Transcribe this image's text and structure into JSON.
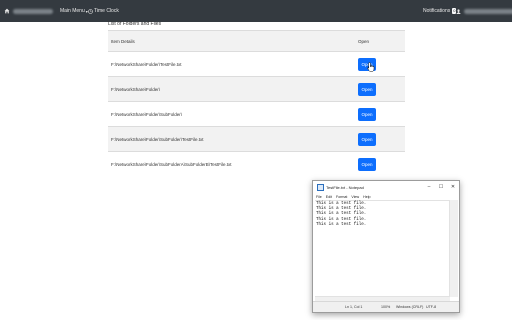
{
  "navbar": {
    "menu_label": "Main Menu",
    "time_clock_label": "Time Clock",
    "notifications_label": "Notifications",
    "notifications_count": "0"
  },
  "section_title": "List of Folders and Files",
  "table": {
    "headers": [
      "Item Details",
      "Open"
    ],
    "rows": [
      {
        "path": "F:\\NetworkShare\\Folder\\TestFile.txt",
        "action": "Open"
      },
      {
        "path": "F:\\NetworkShare\\Folder\\",
        "action": "Open"
      },
      {
        "path": "F:\\NetworkShare\\Folder\\SubFolder\\",
        "action": "Open"
      },
      {
        "path": "F:\\NetworkShare\\Folder\\SubFolder\\TestFile.txt",
        "action": "Open"
      },
      {
        "path": "F:\\NetworkShare\\Folder\\SubFolderA\\SubFolderB\\TestFile.txt",
        "action": "Open"
      }
    ]
  },
  "notepad": {
    "title": "TestFile.txt - Notepad",
    "menu": [
      "File",
      "Edit",
      "Format",
      "View",
      "Help"
    ],
    "content": "This is a test file.\nThis is a test file.\nThis is a test file.\nThis is a test file.\nThis is a test file.",
    "status": {
      "position": "Ln 1, Col 1",
      "zoom": "100%",
      "line_ending": "Windows (CRLF)",
      "encoding": "UTF-8"
    }
  }
}
